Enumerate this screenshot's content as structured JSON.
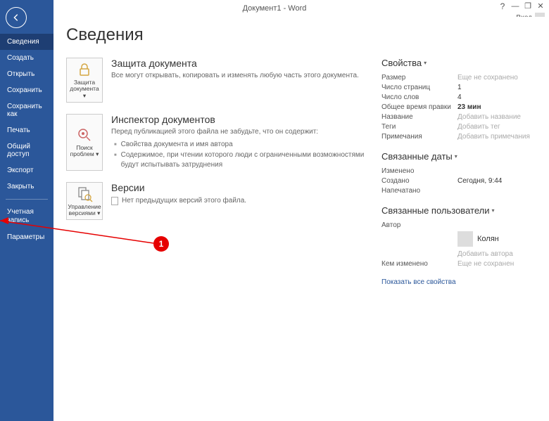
{
  "titlebar": {
    "title": "Документ1 - Word",
    "login": "Вход"
  },
  "sidebar": {
    "items": [
      "Сведения",
      "Создать",
      "Открыть",
      "Сохранить",
      "Сохранить как",
      "Печать",
      "Общий доступ",
      "Экспорт",
      "Закрыть"
    ],
    "account_items": [
      "Учетная запись",
      "Параметры"
    ]
  },
  "page": {
    "title": "Сведения"
  },
  "sections": {
    "protect": {
      "btn": "Защита документа ▾",
      "title": "Защита документа",
      "text": "Все могут открывать, копировать и изменять любую часть этого документа."
    },
    "inspect": {
      "btn": "Поиск проблем ▾",
      "title": "Инспектор документов",
      "text": "Перед публикацией этого файла не забудьте, что он содержит:",
      "b1": "Свойства документа и имя автора",
      "b2": "Содержимое, при чтении которого люди с ограниченными возможностями будут испытывать затруднения"
    },
    "versions": {
      "btn": "Управление версиями ▾",
      "title": "Версии",
      "text": "Нет предыдущих версий этого файла."
    }
  },
  "props": {
    "heading": "Свойства",
    "size_l": "Размер",
    "size_v": "Еще не сохранено",
    "pages_l": "Число страниц",
    "pages_v": "1",
    "words_l": "Число слов",
    "words_v": "4",
    "edit_l": "Общее время правки",
    "edit_v": "23 мин",
    "title_l": "Название",
    "title_v": "Добавить название",
    "tags_l": "Теги",
    "tags_v": "Добавить тег",
    "notes_l": "Примечания",
    "notes_v": "Добавить примечания"
  },
  "dates": {
    "heading": "Связанные даты",
    "mod_l": "Изменено",
    "mod_v": "",
    "created_l": "Создано",
    "created_v": "Сегодня, 9:44",
    "printed_l": "Напечатано",
    "printed_v": ""
  },
  "users": {
    "heading": "Связанные пользователи",
    "author_l": "Автор",
    "author_v": "Колян",
    "add_author": "Добавить автора",
    "changed_l": "Кем изменено",
    "changed_v": "Еще не сохранен"
  },
  "show_all": "Показать все свойства",
  "annotation": {
    "num": "1"
  }
}
